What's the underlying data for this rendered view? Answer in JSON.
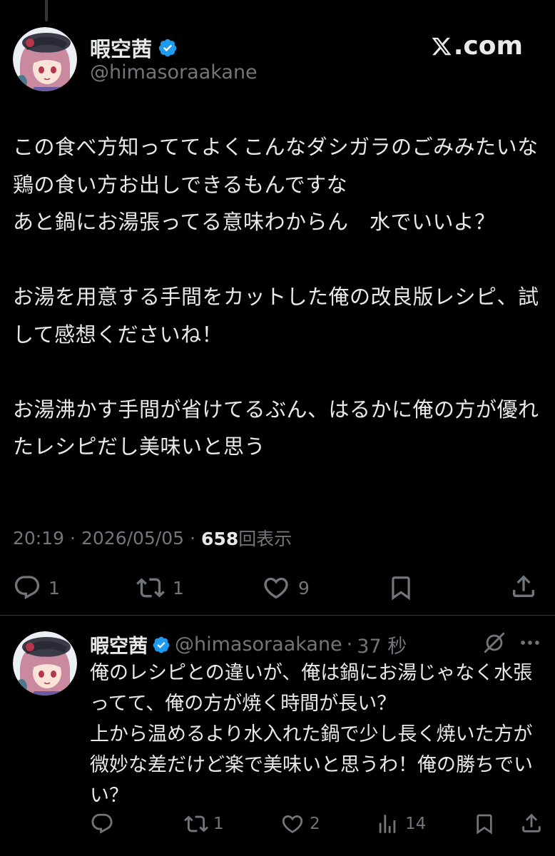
{
  "post": {
    "author_name": "暇空茜",
    "author_handle": "@himasoraakane",
    "source_label": ".com",
    "body": "この食べ方知っててよくこんなダシガラのごみみたいな鶏の食い方お出しできるもんですな\nあと鍋にお湯張ってる意味わからん　水でいいよ？\n\nお湯を用意する手間をカットした俺の改良版レシピ、試して感想くださいね！\n\nお湯沸かす手間が省けてるぶん、はるかに俺の方が優れたレシピだし美味いと思う",
    "time": "20:19",
    "date": "2026/05/05",
    "separator": "·",
    "views": "658",
    "views_label": "回表示",
    "reply_count": "1",
    "repost_count": "1",
    "like_count": "9"
  },
  "reply": {
    "author_name": "暇空茜",
    "author_handle": "@himasoraakane",
    "separator": "·",
    "time_ago": "37 秒",
    "body": "俺のレシピとの違いが、俺は鍋にお湯じゃなく水張ってて、俺の方が焼く時間が長い？\n上から温めるより水入れた鍋で少し長く焼いた方が微妙な差だけど楽で美味いと思うわ！俺の勝ちでいい？",
    "reply_count": "",
    "repost_count": "1",
    "like_count": "2",
    "view_count": "14"
  },
  "colors": {
    "background": "#000000",
    "text": "#e7e9ea",
    "muted": "#71767b",
    "verified": "#1d9bf0"
  },
  "icons": [
    "verified-badge-icon",
    "x-logo-icon",
    "reply-icon",
    "repost-icon",
    "like-icon",
    "bookmark-icon",
    "share-icon",
    "grok-icon",
    "more-icon",
    "views-icon"
  ]
}
